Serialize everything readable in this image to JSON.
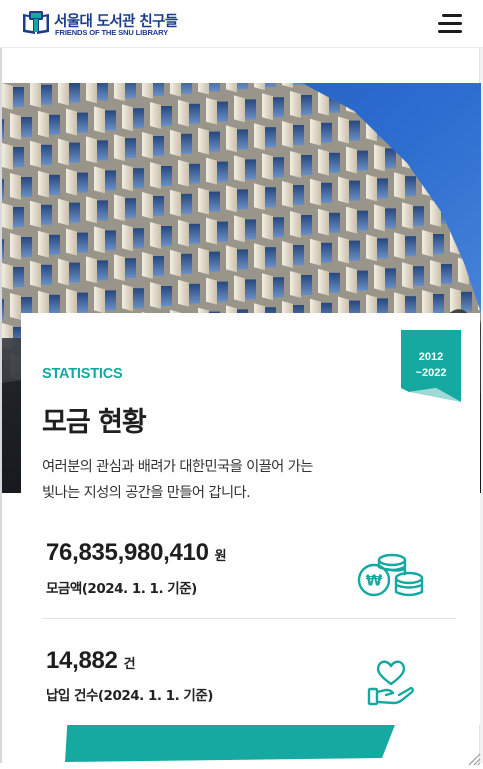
{
  "header": {
    "logo_ko": "서울대 도서관 친구들",
    "logo_en": "FRIENDS OF THE SNU LIBRARY",
    "menu_icon": "hamburger-menu-icon"
  },
  "hero": {
    "image": "modern-library-building-facade"
  },
  "statistics": {
    "ribbon_year_start": "2012",
    "ribbon_year_end": "~2022",
    "eyebrow": "STATISTICS",
    "title": "모금 현황",
    "description_line1": "여러분의 관심과 배려가 대한민국을 이끌어 가는",
    "description_line2": "빛나는 지성의 공간을 만들어 갑니다.",
    "items": [
      {
        "value": "76,835,980,410",
        "unit": "원",
        "label": "모금액(2024. 1. 1. 기준)",
        "icon": "coins-won-icon"
      },
      {
        "value": "14,882",
        "unit": "건",
        "label": "납입 건수(2024. 1. 1. 기준)",
        "icon": "hand-heart-icon"
      }
    ]
  },
  "colors": {
    "brand_navy": "#1b3b8c",
    "accent_teal": "#13a9a1",
    "ribbon_teal": "#16a9a2",
    "text_dark": "#1f1f1f"
  }
}
